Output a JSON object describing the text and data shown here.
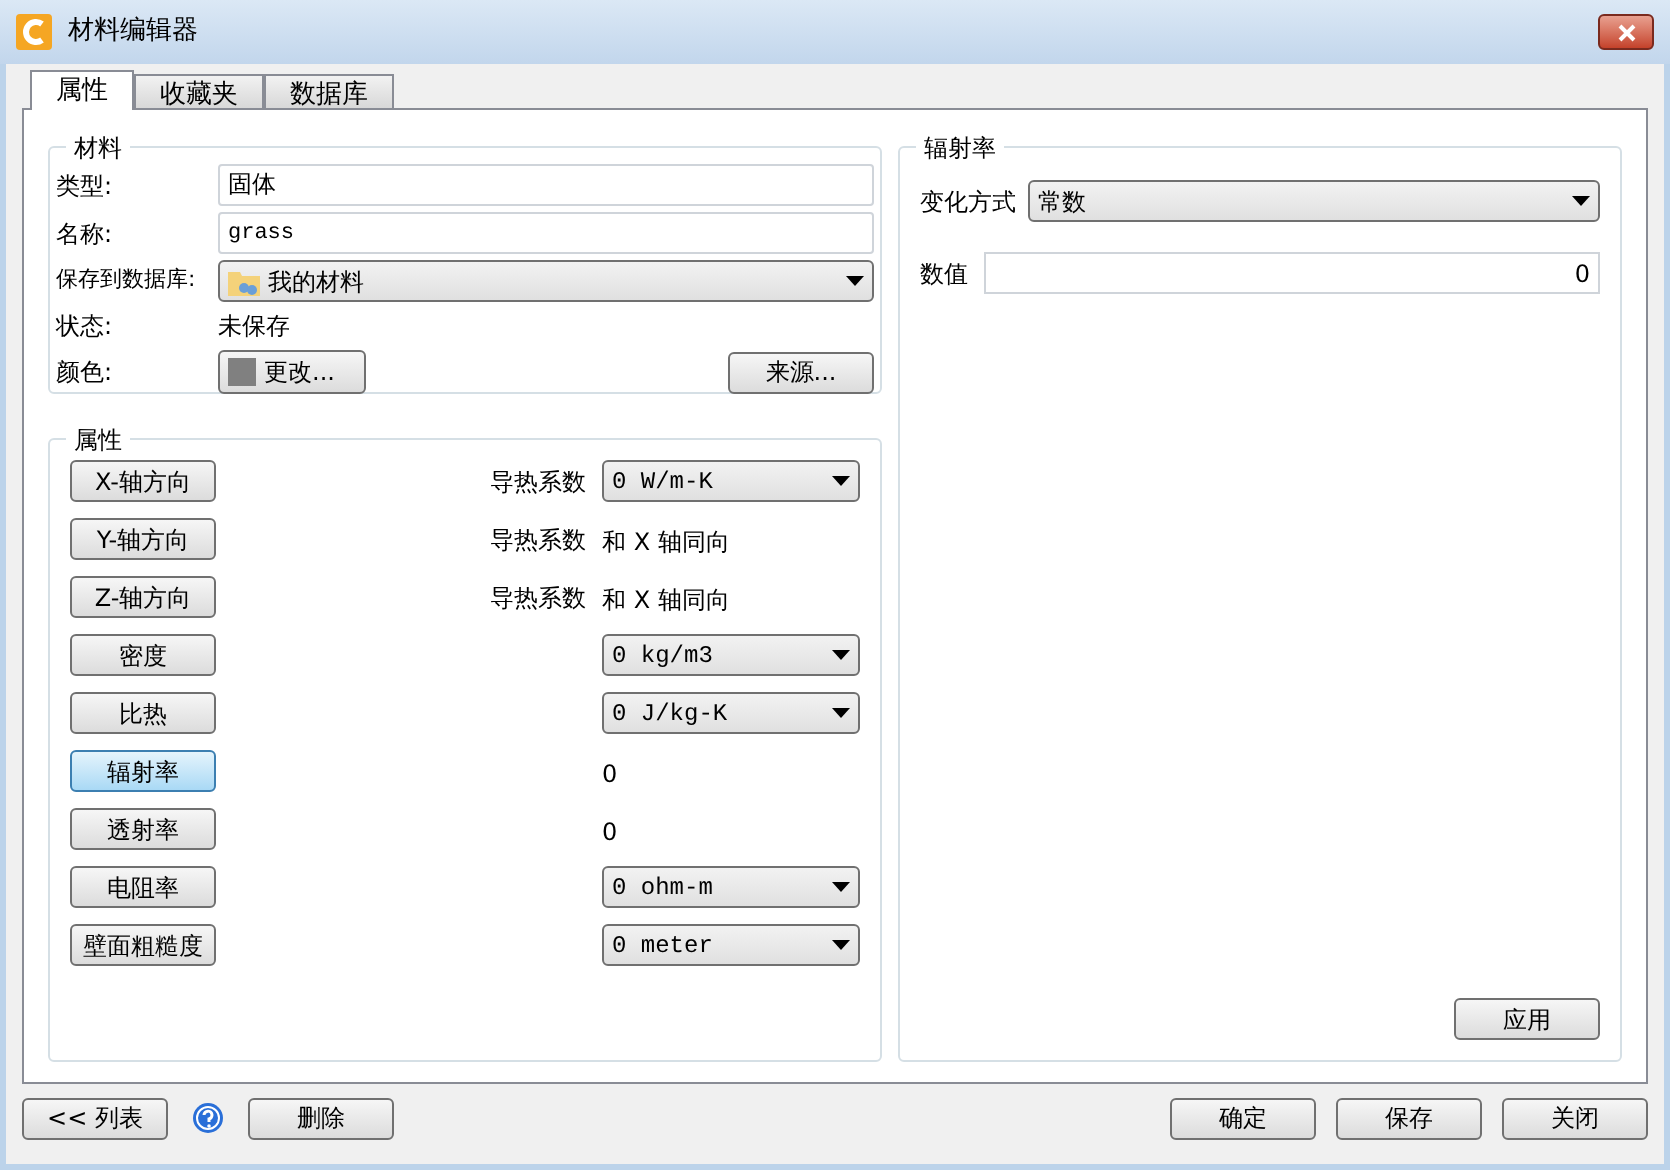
{
  "window": {
    "title": "材料编辑器"
  },
  "tabs": [
    {
      "label": "属性",
      "selected": true
    },
    {
      "label": "收藏夹",
      "selected": false
    },
    {
      "label": "数据库",
      "selected": false
    }
  ],
  "material": {
    "title": "材料",
    "type_label": "类型:",
    "type_value": "固体",
    "name_label": "名称:",
    "name_value": "grass",
    "save_label": "保存到数据库:",
    "save_value": "我的材料",
    "status_label": "状态:",
    "status_value": "未保存",
    "color_label": "颜色:",
    "color": "#808080",
    "change_button": "更改...",
    "source_button": "来源..."
  },
  "properties": {
    "title": "属性",
    "rows": [
      {
        "button": "X-轴方向",
        "selected": false,
        "kind": "dropdown",
        "label": "导热系数",
        "value": "0 W/m-K"
      },
      {
        "button": "Y-轴方向",
        "selected": false,
        "kind": "text",
        "label": "导热系数",
        "value": "和 X 轴同向"
      },
      {
        "button": "Z-轴方向",
        "selected": false,
        "kind": "text",
        "label": "导热系数",
        "value": "和 X 轴同向"
      },
      {
        "button": "密度",
        "selected": false,
        "kind": "dropdown",
        "value": "0 kg/m3"
      },
      {
        "button": "比热",
        "selected": false,
        "kind": "dropdown",
        "value": "0 J/kg-K"
      },
      {
        "button": "辐射率",
        "selected": true,
        "kind": "text",
        "value": "0"
      },
      {
        "button": "透射率",
        "selected": false,
        "kind": "text",
        "value": "0"
      },
      {
        "button": "电阻率",
        "selected": false,
        "kind": "dropdown",
        "value": "0 ohm-m"
      },
      {
        "button": "壁面粗糙度",
        "selected": false,
        "kind": "dropdown",
        "value": "0 meter"
      }
    ]
  },
  "detail": {
    "title": "辐射率",
    "mode_label": "变化方式",
    "mode_value": "常数",
    "value_label": "数值",
    "value": "0",
    "apply_button": "应用"
  },
  "footer": {
    "list_button": "<< 列表",
    "delete_button": "删除",
    "ok_button": "确定",
    "save_button": "保存",
    "close_button": "关闭"
  }
}
